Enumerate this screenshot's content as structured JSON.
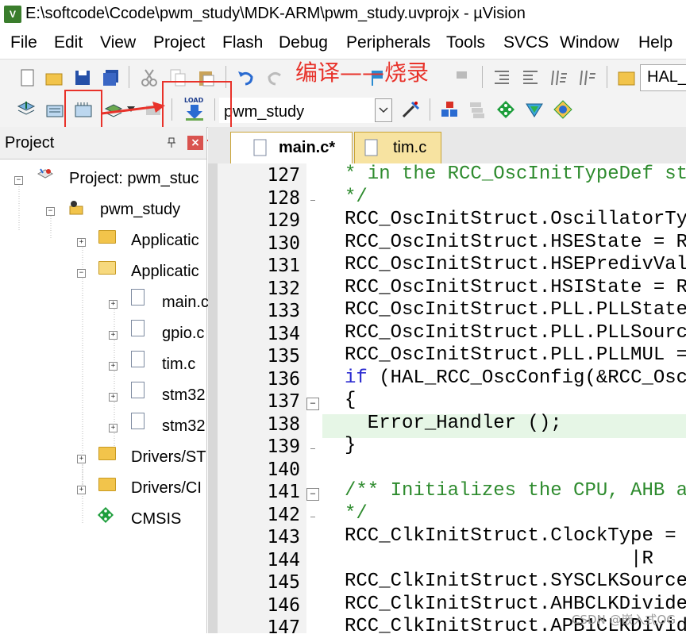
{
  "window": {
    "title": "E:\\softcode\\Ccode\\pwm_study\\MDK-ARM\\pwm_study.uvprojx - µVision",
    "app_icon_text": "V"
  },
  "menu": [
    "File",
    "Edit",
    "View",
    "Project",
    "Flash",
    "Debug",
    "Peripherals",
    "Tools",
    "SVCS",
    "Window",
    "Help"
  ],
  "toolbar1": {
    "right_combo_text": "HAL_"
  },
  "toolbar2": {
    "target_select": "pwm_study",
    "load_icon_text": "LOAD"
  },
  "annotation": {
    "text": "编译——烧录",
    "color": "#e8322a"
  },
  "project_panel": {
    "title": "Project",
    "tree": [
      {
        "label": "Project: pwm_stuc",
        "level": 0,
        "expander": "−"
      },
      {
        "label": "pwm_study",
        "level": 1,
        "expander": "−"
      },
      {
        "label": "Applicatic",
        "level": 2,
        "expander": "+"
      },
      {
        "label": "Applicatic",
        "level": 2,
        "expander": "−"
      },
      {
        "label": "main.c",
        "level": 3,
        "expander": "+"
      },
      {
        "label": "gpio.c",
        "level": 3,
        "expander": "+"
      },
      {
        "label": "tim.c",
        "level": 3,
        "expander": "+"
      },
      {
        "label": "stm32",
        "level": 3,
        "expander": "+"
      },
      {
        "label": "stm32",
        "level": 3,
        "expander": "+"
      },
      {
        "label": "Drivers/ST",
        "level": 2,
        "expander": "+"
      },
      {
        "label": "Drivers/CI",
        "level": 2,
        "expander": "+"
      },
      {
        "label": "CMSIS",
        "level": 2,
        "expander": ""
      }
    ]
  },
  "tabs": [
    {
      "label": "main.c*",
      "active": true
    },
    {
      "label": "tim.c",
      "active": false
    }
  ],
  "editor": {
    "lines": [
      {
        "n": "127",
        "text": "* in the RCC_OscInitTypeDef st",
        "type": "cmt",
        "fold": ""
      },
      {
        "n": "128",
        "text": "*/",
        "type": "cmt",
        "fold": "-"
      },
      {
        "n": "129",
        "text": "RCC_OscInitStruct.OscillatorTy",
        "type": "code",
        "fold": ""
      },
      {
        "n": "130",
        "text": "RCC_OscInitStruct.HSEState = R",
        "type": "code",
        "fold": ""
      },
      {
        "n": "131",
        "text": "RCC_OscInitStruct.HSEPredivVal",
        "type": "code",
        "fold": ""
      },
      {
        "n": "132",
        "text": "RCC_OscInitStruct.HSIState = R",
        "type": "code",
        "fold": ""
      },
      {
        "n": "133",
        "text": "RCC_OscInitStruct.PLL.PLLState",
        "type": "code",
        "fold": ""
      },
      {
        "n": "134",
        "text": "RCC_OscInitStruct.PLL.PLLSourc",
        "type": "code",
        "fold": ""
      },
      {
        "n": "135",
        "text": "RCC_OscInitStruct.PLL.PLLMUL =",
        "type": "code",
        "fold": ""
      },
      {
        "n": "136",
        "text": "(HAL_RCC_OscConfig(&RCC_Osc",
        "type": "if",
        "fold": ""
      },
      {
        "n": "137",
        "text": "{",
        "type": "code",
        "fold": "box"
      },
      {
        "n": "138",
        "text": "  Error_Handler ();",
        "type": "code",
        "fold": ""
      },
      {
        "n": "139",
        "text": "}",
        "type": "code",
        "fold": "-"
      },
      {
        "n": "140",
        "text": "",
        "type": "code",
        "fold": ""
      },
      {
        "n": "141",
        "text": "/** Initializes the CPU, AHB a",
        "type": "cmt",
        "fold": "box"
      },
      {
        "n": "142",
        "text": "*/",
        "type": "cmt",
        "fold": "-"
      },
      {
        "n": "143",
        "text": "RCC_ClkInitStruct.ClockType =",
        "type": "code",
        "fold": ""
      },
      {
        "n": "144",
        "text": "                         |R",
        "type": "code",
        "fold": ""
      },
      {
        "n": "145",
        "text": "RCC_ClkInitStruct.SYSCLKSource",
        "type": "code",
        "fold": ""
      },
      {
        "n": "146",
        "text": "RCC_ClkInitStruct.AHBCLKDivide",
        "type": "code",
        "fold": ""
      },
      {
        "n": "147",
        "text": "RCC_ClkInitStruct.APB1CLKDivid",
        "type": "code",
        "fold": ""
      }
    ],
    "if_keyword": "if",
    "highlight_line": "138"
  },
  "watermark": "CSDN @嵌入式OG"
}
